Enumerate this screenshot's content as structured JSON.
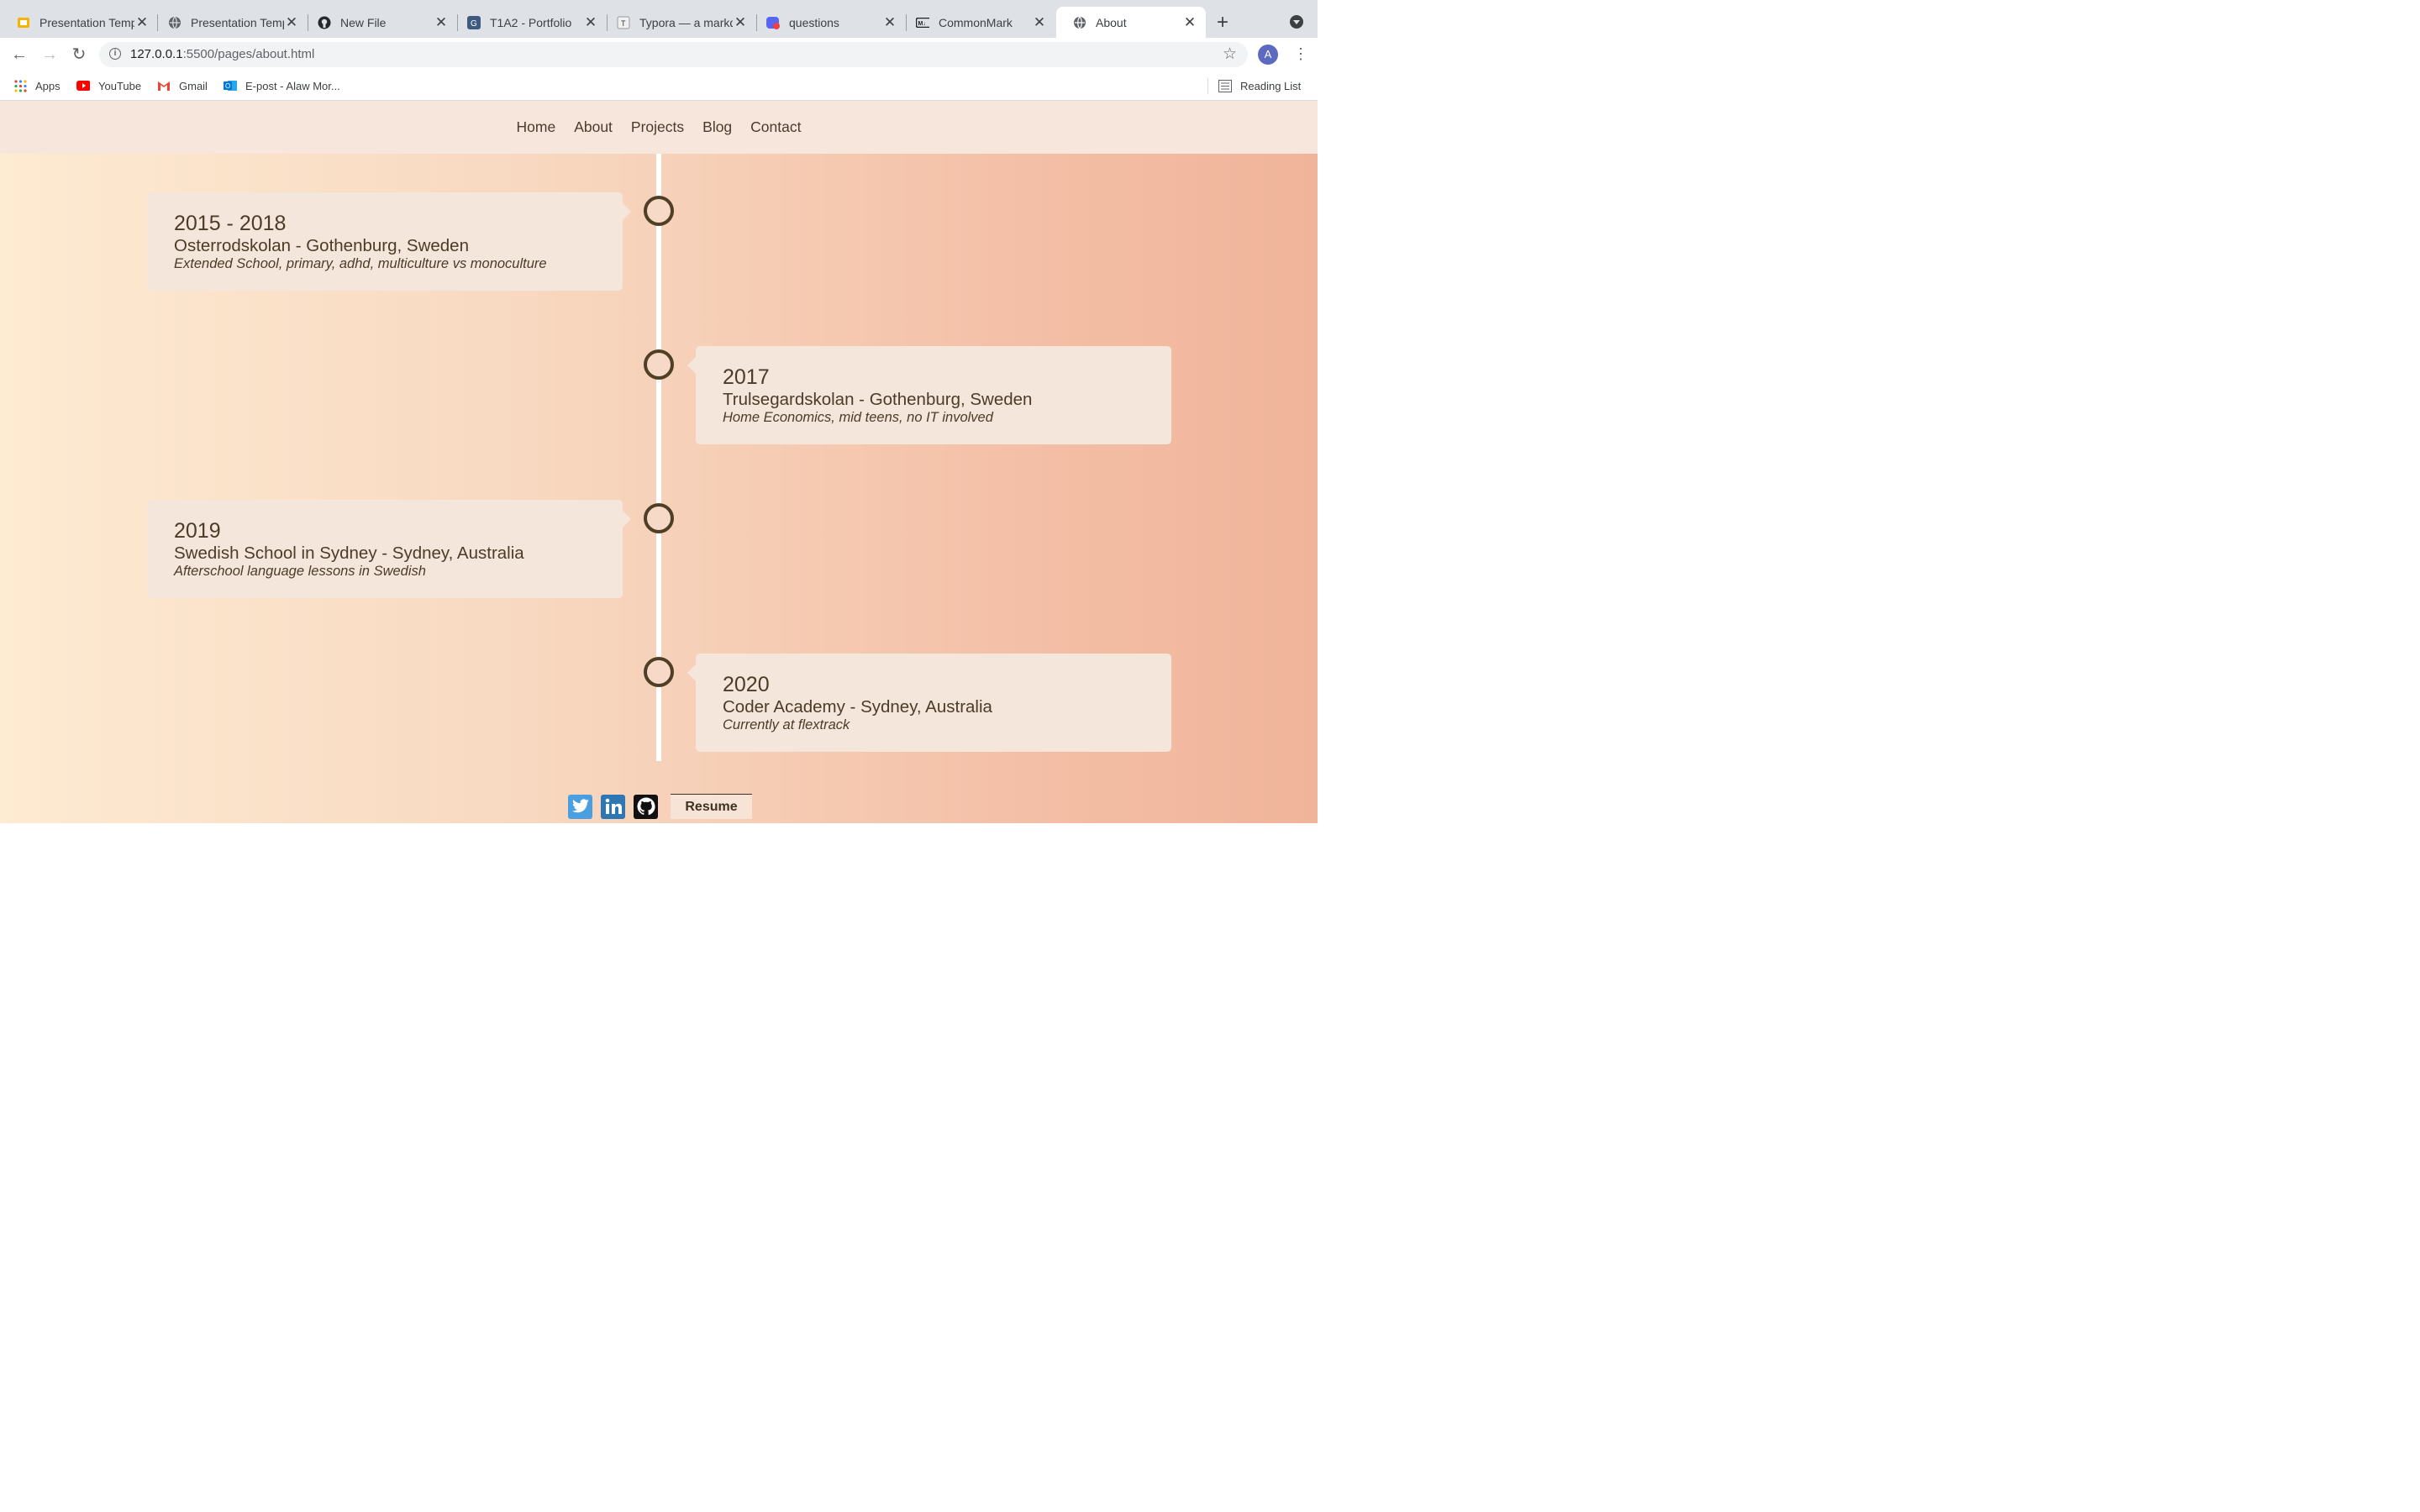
{
  "browser": {
    "tabs": [
      {
        "title": "Presentation Temp",
        "favicon": "slides-icon",
        "active": false
      },
      {
        "title": "Presentation Temp",
        "favicon": "globe-icon",
        "active": false
      },
      {
        "title": "New File",
        "favicon": "github-icon",
        "active": false
      },
      {
        "title": "T1A2 - Portfolio",
        "favicon": "canvas-icon",
        "active": false
      },
      {
        "title": "Typora — a markd",
        "favicon": "typora-icon",
        "active": false
      },
      {
        "title": "questions",
        "favicon": "discord-icon",
        "active": false
      },
      {
        "title": "CommonMark",
        "favicon": "markdown-icon",
        "active": false
      },
      {
        "title": "About",
        "favicon": "globe-icon",
        "active": true
      }
    ],
    "url_host": "127.0.0.1",
    "url_rest": ":5500/pages/about.html",
    "profile_initial": "A",
    "bookmarks": [
      {
        "label": "Apps",
        "icon": "apps-grid-icon"
      },
      {
        "label": "YouTube",
        "icon": "youtube-icon"
      },
      {
        "label": "Gmail",
        "icon": "gmail-icon"
      },
      {
        "label": "E-post - Alaw Mor...",
        "icon": "outlook-icon"
      }
    ],
    "reading_list": "Reading List"
  },
  "site": {
    "nav": [
      "Home",
      "About",
      "Projects",
      "Blog",
      "Contact"
    ],
    "timeline": [
      {
        "year": "2015 - 2018",
        "school": "Osterrodskolan - Gothenburg, Sweden",
        "desc": "Extended School, primary, adhd, multiculture vs monoculture",
        "side": "left"
      },
      {
        "year": "2017",
        "school": "Trulsegardskolan - Gothenburg, Sweden",
        "desc": "Home Economics, mid teens, no IT involved",
        "side": "right"
      },
      {
        "year": "2019",
        "school": "Swedish School in Sydney - Sydney, Australia",
        "desc": "Afterschool language lessons in Swedish",
        "side": "left"
      },
      {
        "year": "2020",
        "school": "Coder Academy - Sydney, Australia",
        "desc": "Currently at flextrack",
        "side": "right"
      }
    ],
    "footer": {
      "social": [
        "twitter-icon",
        "linkedin-icon",
        "github-icon"
      ],
      "resume_label": "Resume"
    }
  },
  "colors": {
    "text_brown": "#4c3b28",
    "card_bg": "#f5e6dc",
    "nav_bg": "#f6e6dc",
    "twitter": "#4a9fe0",
    "linkedin": "#2e77b5"
  }
}
